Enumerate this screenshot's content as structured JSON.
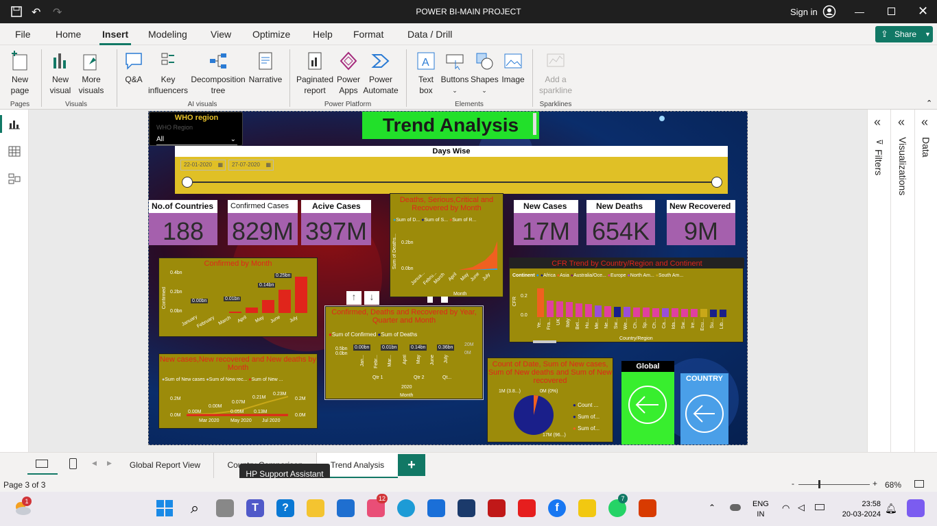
{
  "window": {
    "title": "POWER BI-MAIN PROJECT",
    "sign_in": "Sign in"
  },
  "ribbon_tabs": [
    "File",
    "Home",
    "Insert",
    "Modeling",
    "View",
    "Optimize",
    "Help",
    "Format",
    "Data / Drill"
  ],
  "share_label": "Share",
  "ribbon": {
    "pages": {
      "new_page": "New\npage",
      "group": "Pages"
    },
    "visuals": {
      "new_visual": "New\nvisual",
      "more_visuals": "More\nvisuals",
      "group": "Visuals"
    },
    "ai": {
      "qa": "Q&A",
      "key": "Key\ninfluencers",
      "decomp": "Decomposition\ntree",
      "narrative": "Narrative",
      "group": "AI visuals"
    },
    "pp": {
      "paginated": "Paginated\nreport",
      "powerapps": "Power\nApps",
      "automate": "Power\nAutomate",
      "group": "Power Platform"
    },
    "el": {
      "textbox": "Text\nbox",
      "buttons": "Buttons",
      "shapes": "Shapes",
      "image": "Image",
      "group": "Elements"
    },
    "spark": {
      "add": "Add a\nsparkline",
      "group": "Sparklines"
    }
  },
  "report": {
    "slicer": {
      "title": "WHO region",
      "sub": "WHO Region",
      "value": "All"
    },
    "title": "Trend Analysis",
    "dates": {
      "title": "Days Wise",
      "start": "22-01-2020",
      "end": "27-07-2020"
    },
    "cards": [
      {
        "label": "No.of Countries",
        "value": "188"
      },
      {
        "label": "Confirmed Cases",
        "value": "829M"
      },
      {
        "label": "Acive Cases",
        "value": "397M"
      },
      {
        "label": "New Cases",
        "value": "17M"
      },
      {
        "label": "New Deaths",
        "value": "654K"
      },
      {
        "label": "New Recovered",
        "value": "9M"
      }
    ],
    "deaths_chart": {
      "title": "Deaths, Serious,Critical and Recovered by Month",
      "legend": [
        "Sum of D...",
        "Sum of S...",
        "Sum of R..."
      ],
      "ylabel": "Sum of Deaths...",
      "yticks": [
        "0.2bn",
        "0.0bn"
      ],
      "xticks": [
        "Janua...",
        "Febru...",
        "March",
        "April",
        "May",
        "June",
        "July"
      ],
      "xlabel": "Month"
    },
    "confirmed_month": {
      "title": "Confirmed by Month",
      "ylabel": "Confirmed",
      "yticks": [
        "0.4bn",
        "0.2bn",
        "0.0bn"
      ],
      "months": [
        "January",
        "February",
        "March",
        "April",
        "May",
        "June",
        "July"
      ],
      "labels": [
        "0.00bn",
        "0.01bn",
        "0.14bn",
        "0.25bn"
      ]
    },
    "cfd_year": {
      "title": "Confirmed, Deaths and Recovered by Year, Quarter and Month",
      "legend": [
        "Sum of Confirmed",
        "Sum of Deaths"
      ],
      "yticks": [
        "0.5bn",
        "0.0bn"
      ],
      "y2ticks": [
        "20M",
        "0M"
      ],
      "labels": [
        "0.00bn",
        "0.01bn",
        "0.14bn",
        "0.36bn"
      ],
      "months": [
        "Jan...",
        "Febr...",
        "Mar...",
        "April",
        "May",
        "June",
        "July"
      ],
      "quarters": [
        "Qtr 1",
        "Qtr 2",
        "Qt..."
      ],
      "year": "2020",
      "xlabel": "Month"
    },
    "cfr": {
      "title": "CFR Trend by Country/Region and Continent",
      "legend_title": "Continent",
      "legend": [
        "Africa",
        "Asia",
        "Australia/Oce...",
        "Europe",
        "North Am...",
        "South Am..."
      ],
      "yticks": [
        "0.2",
        "0.0"
      ],
      "ylabel": "CFR",
      "xlabel": "Country/Region",
      "countries": [
        "Ye...",
        "Fra...",
        "UK",
        "Italy",
        "Bel...",
        "Hu...",
        "Me...",
        "Ne...",
        "Sw...",
        "We...",
        "Ch...",
        "Sp...",
        "Ch...",
        "Ca...",
        "Ida...",
        "Sw...",
        "Ire...",
        "Ecu...",
        "Su...",
        "Lib..."
      ]
    },
    "newcases": {
      "title": "New cases,New recovered and New deaths by Month",
      "legend": [
        "Sum of New cases",
        "Sum of New rec...",
        "Sum of New ..."
      ],
      "yticks": [
        "0.2M",
        "0.0M"
      ],
      "y2ticks": [
        "0.2M",
        "0.0M"
      ],
      "xticks": [
        "Mar 2020",
        "May 2020",
        "Jul 2020"
      ],
      "labels": [
        "0.00M",
        "0.00M",
        "0.07M",
        "0.21M",
        "0.23M",
        "0.05M",
        "0.13M"
      ]
    },
    "pie": {
      "title": "Count of Date, Sum of New cases, Sum of New deaths and Sum of New recovered",
      "labels": [
        "1M (3.8...)",
        "0M (0%)",
        "17M (96...)"
      ],
      "legend": [
        "Count ...",
        "Sum of...",
        "Sum of..."
      ]
    },
    "global_btn": "Global",
    "country_btn": "COUNTRY"
  },
  "panes": [
    "Filters",
    "Visualizations",
    "Data"
  ],
  "page_tabs": [
    "Global Report View",
    "Country Comparison",
    "Trend Analysis"
  ],
  "tooltip": "HP Support Assistant",
  "status": {
    "page": "Page 3 of 3",
    "zoom": "68%"
  },
  "taskbar": {
    "lang": "ENG",
    "lang2": "IN",
    "time": "23:58",
    "date": "20-03-2024",
    "badge1": "1",
    "badge2": "12",
    "badge3": "7"
  },
  "colors": {
    "accent": "#117865",
    "chart_bg": "#9c8b0a",
    "title_red": "#e0251b",
    "card_purple": "#a560ad",
    "title_green": "#22e02a",
    "global_green": "#38ee2e",
    "country_blue": "#4a9fe8"
  }
}
